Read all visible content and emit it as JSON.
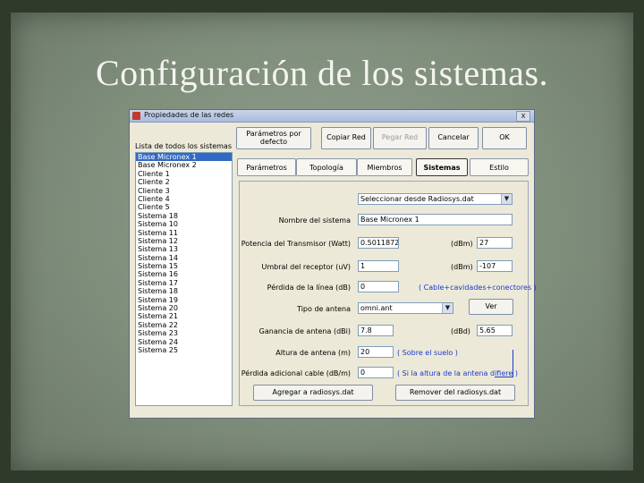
{
  "slide": {
    "title": "Configuración de los sistemas."
  },
  "window": {
    "title": "Propiedades de las redes",
    "close_label": "X"
  },
  "toolbar": {
    "btn_params_default": "Parámetros por defecto",
    "btn_copy": "Copiar Red",
    "btn_paste": "Pegar Red",
    "btn_cancel": "Cancelar",
    "btn_ok": "OK"
  },
  "systems_list": {
    "label": "Lista de todos los sistemas",
    "items": [
      "Base Micronex 1",
      "Base Micronex 2",
      "Cliente 1",
      "Cliente 2",
      "Cliente 3",
      "Cliente 4",
      "Cliente 5",
      "Sistema 18",
      "Sistema 10",
      "Sistema 11",
      "Sistema 12",
      "Sistema 13",
      "Sistema 14",
      "Sistema 15",
      "Sistema 16",
      "Sistema 17",
      "Sistema 18",
      "Sistema 19",
      "Sistema 20",
      "Sistema 21",
      "Sistema 22",
      "Sistema 23",
      "Sistema 24",
      "Sistema 25"
    ],
    "selected_index": 0
  },
  "tabs": [
    "Parámetros",
    "Topología",
    "Miembros",
    "Sistemas",
    "Estilo"
  ],
  "active_tab": 3,
  "form": {
    "radio_select": "Seleccionar desde Radiosys.dat",
    "system_name_label": "Nombre del sistema",
    "system_name_value": "Base Micronex 1",
    "tx_power_label": "Potencia del Transmisor (Watt)",
    "tx_power_value": "0.5011872",
    "tx_power_dbm_unit": "(dBm)",
    "tx_power_dbm_value": "27",
    "rx_threshold_label": "Umbral del receptor (uV)",
    "rx_threshold_value": "1",
    "rx_threshold_dbm_unit": "(dBm)",
    "rx_threshold_dbm_value": "-107",
    "line_loss_label": "Pérdida de la línea (dB)",
    "line_loss_value": "0",
    "line_loss_note": "( Cable+cavidades+conectores )",
    "antenna_type_label": "Tipo de antena",
    "antenna_type_value": "omni.ant",
    "view_button": "Ver",
    "antenna_gain_label": "Ganancia de antena (dBi)",
    "antenna_gain_value": "7.8",
    "antenna_gain_dbd_unit": "(dBd)",
    "antenna_gain_dbd_value": "5.65",
    "antenna_height_label": "Altura de antena (m)",
    "antenna_height_value": "20",
    "antenna_height_note": "( Sobre el suelo )",
    "extra_loss_label": "Pérdida adicional cable (dB/m)",
    "extra_loss_value": "0",
    "extra_loss_note": "( Si la altura de la antena difiere )",
    "add_button": "Agregar a radiosys.dat",
    "remove_button": "Remover del radiosys.dat"
  },
  "colors": {
    "selection": "#316ac5",
    "note_text": "#1a3ccf",
    "dialog_bg": "#ece9d8"
  }
}
